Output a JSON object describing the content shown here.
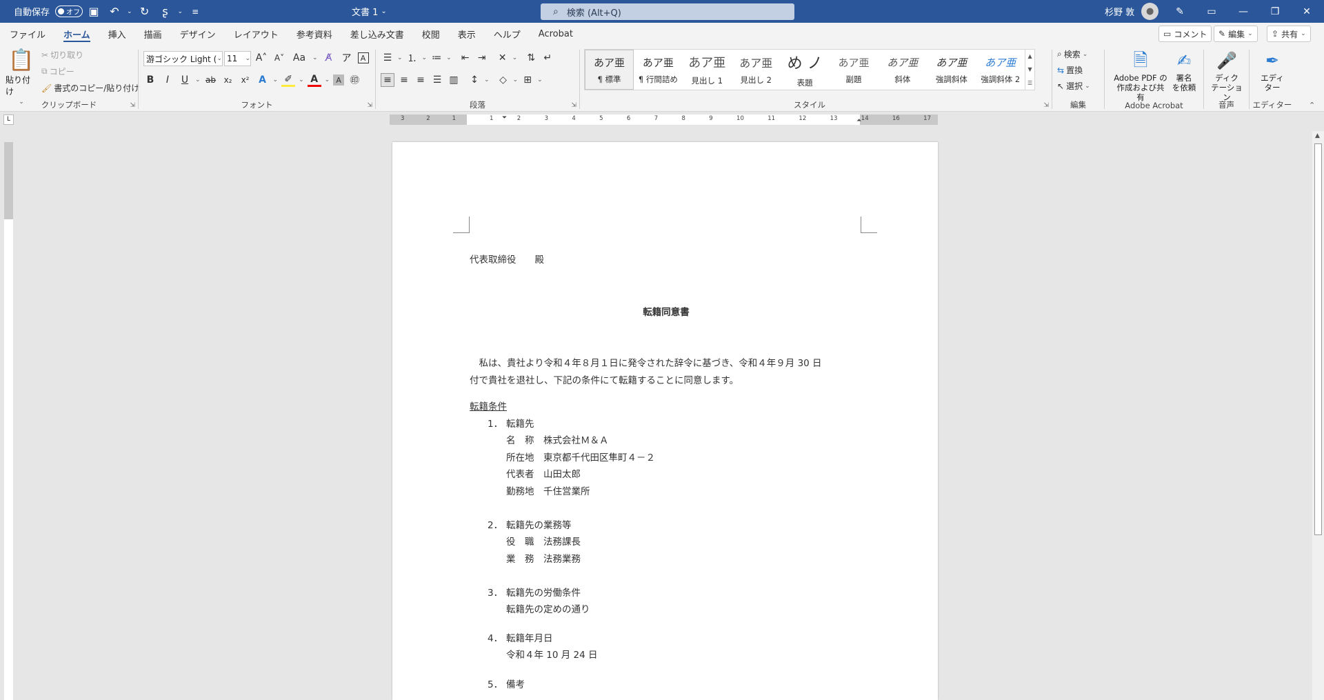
{
  "titlebar": {
    "autosave_label": "自動保存",
    "autosave_state": "オフ",
    "doc_title": "文書 1",
    "search_placeholder": "検索 (Alt+Q)",
    "user_name": "杉野 敦"
  },
  "menu": {
    "tabs": [
      "ファイル",
      "ホーム",
      "挿入",
      "描画",
      "デザイン",
      "レイアウト",
      "参考資料",
      "差し込み文書",
      "校閲",
      "表示",
      "ヘルプ",
      "Acrobat"
    ],
    "active": "ホーム",
    "comment_label": "コメント",
    "edit_label": "編集",
    "share_label": "共有"
  },
  "ribbon": {
    "clipboard": {
      "paste": "貼り付け",
      "cut": "切り取り",
      "copy": "コピー",
      "format_painter": "書式のコピー/貼り付け",
      "label": "クリップボード"
    },
    "font": {
      "name": "游ゴシック Light (見",
      "size": "11",
      "aa": "Aa",
      "label": "フォント"
    },
    "paragraph": {
      "label": "段落"
    },
    "styles": {
      "items": [
        {
          "preview": "あア亜",
          "name": "¶ 標準"
        },
        {
          "preview": "あア亜",
          "name": "¶ 行間詰め"
        },
        {
          "preview": "あア亜",
          "name": "見出し 1"
        },
        {
          "preview": "あア亜",
          "name": "見出し 2"
        },
        {
          "preview": "め ノ",
          "name": "表題"
        },
        {
          "preview": "あア亜",
          "name": "副題"
        },
        {
          "preview": "あア亜",
          "name": "斜体"
        },
        {
          "preview": "あア亜",
          "name": "強調斜体"
        },
        {
          "preview": "あア亜",
          "name": "強調斜体 2"
        }
      ],
      "label": "スタイル"
    },
    "editing": {
      "find": "検索",
      "replace": "置換",
      "select": "選択",
      "label": "編集"
    },
    "acrobat": {
      "create_pdf": [
        "Adobe PDF の",
        "作成および共有"
      ],
      "sign": [
        "署名",
        "を依頼"
      ],
      "label": "Adobe Acrobat"
    },
    "voice": {
      "dictate": [
        "ディク",
        "テーション"
      ],
      "label": "音声"
    },
    "editor": {
      "name": [
        "エディ",
        "ター"
      ],
      "label": "エディター"
    }
  },
  "ruler": {
    "corner": "L",
    "h_left": [
      "3",
      "2",
      "1"
    ],
    "h_right": [
      "1",
      "2",
      "3",
      "4",
      "5",
      "6",
      "7",
      "8",
      "9",
      "10",
      "11",
      "12",
      "13",
      "14",
      "16",
      "17"
    ]
  },
  "document": {
    "addressee": "代表取締役　　殿",
    "title": "転籍同意書",
    "body": [
      "　私は、貴社より令和４年８月１日に発令された辞令に基づき、令和４年９月 30 日",
      "付で貴社を退社し、下記の条件にて転籍することに同意します。"
    ],
    "conditions_heading": "転籍条件",
    "items": [
      {
        "num": "1．",
        "label": "転籍先",
        "details": [
          "名　称　株式会社Ｍ＆Ａ",
          "所在地　東京都千代田区隼町４－２",
          "代表者　山田太郎",
          "勤務地　千住営業所"
        ]
      },
      {
        "num": "2．",
        "label": "転籍先の業務等",
        "details": [
          "役　職　法務課長",
          "業　務　法務業務"
        ]
      },
      {
        "num": "3．",
        "label": "転籍先の労働条件",
        "details": [
          "転籍先の定めの通り"
        ]
      },
      {
        "num": "4．",
        "label": "転籍年月日",
        "details": [
          "令和４年 10 月 24 日"
        ]
      },
      {
        "num": "5．",
        "label": "備考",
        "details": []
      }
    ]
  }
}
